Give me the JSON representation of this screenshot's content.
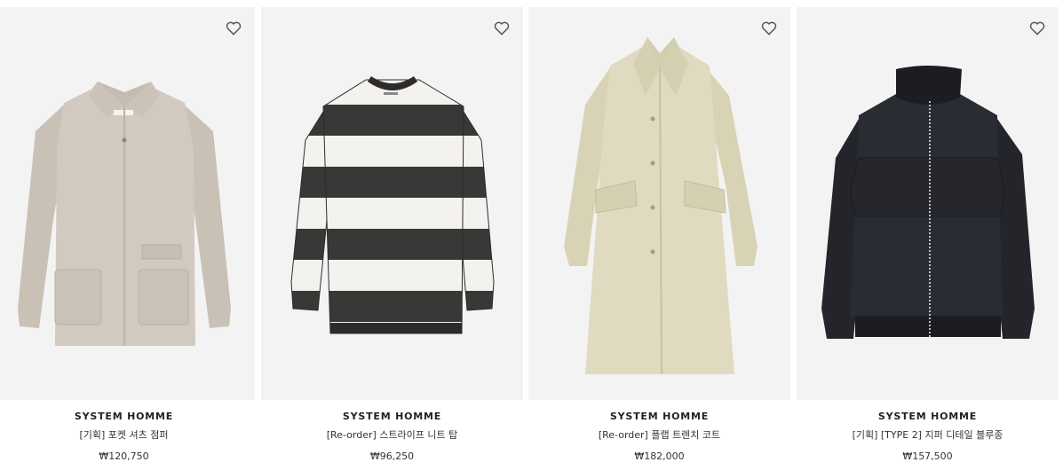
{
  "products": [
    {
      "brand": "SYSTEM HOMME",
      "name": "[기획] 포켓 셔츠 점퍼",
      "price": "₩120,750",
      "wishlist_icon": "heart-outline-icon",
      "image": "beige-shirt-jacket"
    },
    {
      "brand": "SYSTEM HOMME",
      "name": "[Re-order] 스트라이프 니트 탑",
      "price": "₩96,250",
      "wishlist_icon": "heart-outline-icon",
      "image": "black-white-striped-knit"
    },
    {
      "brand": "SYSTEM HOMME",
      "name": "[Re-order] 플랩 트렌치 코트",
      "price": "₩182,000",
      "wishlist_icon": "heart-outline-icon",
      "image": "khaki-trench-coat"
    },
    {
      "brand": "SYSTEM HOMME",
      "name": "[기획] [TYPE 2] 지퍼 디테일 블루종",
      "price": "₩157,500",
      "wishlist_icon": "heart-outline-icon",
      "image": "black-zip-blouson"
    }
  ],
  "colors": {
    "thumb_bg": "#f3f3f3",
    "text": "#333333"
  }
}
